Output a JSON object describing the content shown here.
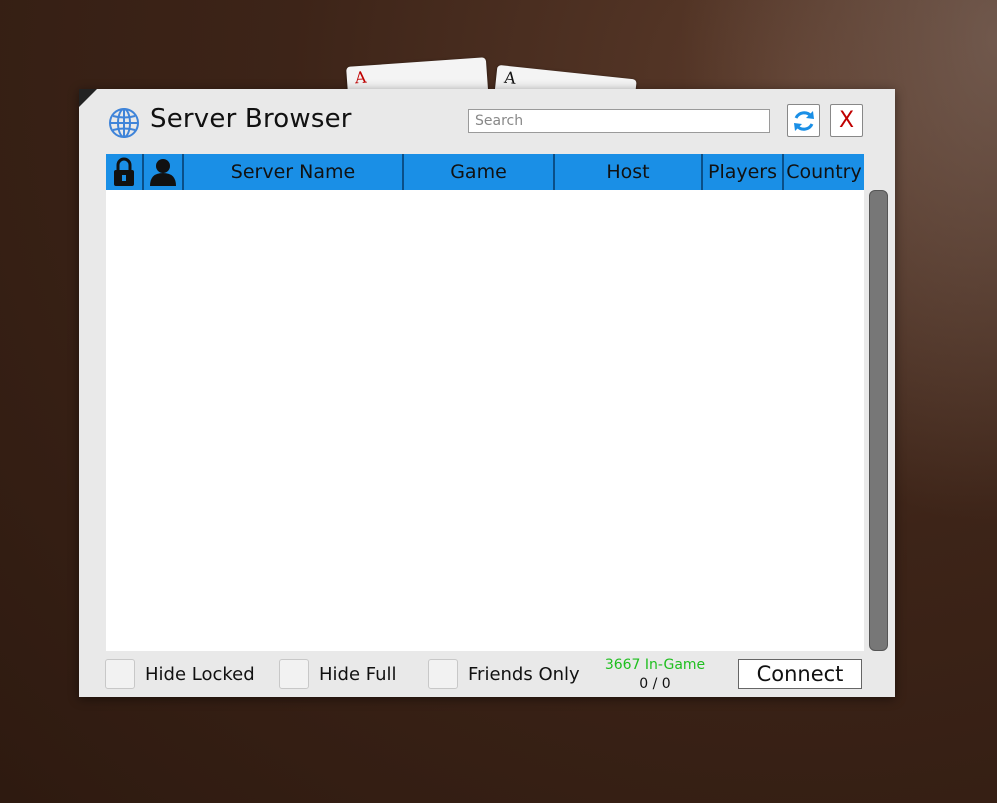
{
  "background": {
    "base_color": "#3d2418"
  },
  "cards": [
    {
      "mark": "A",
      "mark_color": "#c00000"
    },
    {
      "mark": "A",
      "mark_color": "#111111"
    }
  ],
  "window": {
    "title": "Server Browser",
    "title_icon": "globe-icon",
    "search": {
      "placeholder": "Search",
      "value": ""
    },
    "refresh_icon": "refresh-icon",
    "close_label": "X",
    "accent_color": "#1a8fe6"
  },
  "table": {
    "columns": [
      {
        "key": "locked",
        "label": "",
        "icon": "lock-icon"
      },
      {
        "key": "user",
        "label": "",
        "icon": "user-icon"
      },
      {
        "key": "server_name",
        "label": "Server Name"
      },
      {
        "key": "game",
        "label": "Game"
      },
      {
        "key": "host",
        "label": "Host"
      },
      {
        "key": "players",
        "label": "Players"
      },
      {
        "key": "country",
        "label": "Country"
      }
    ],
    "rows": []
  },
  "footer": {
    "filters": [
      {
        "label": "Hide Locked",
        "checked": false
      },
      {
        "label": "Hide Full",
        "checked": false
      },
      {
        "label": "Friends Only",
        "checked": false
      }
    ],
    "in_game_text": "3667 In-Game",
    "server_count_text": "0 / 0",
    "in_game_color": "#1fbf1f",
    "connect_label": "Connect"
  }
}
